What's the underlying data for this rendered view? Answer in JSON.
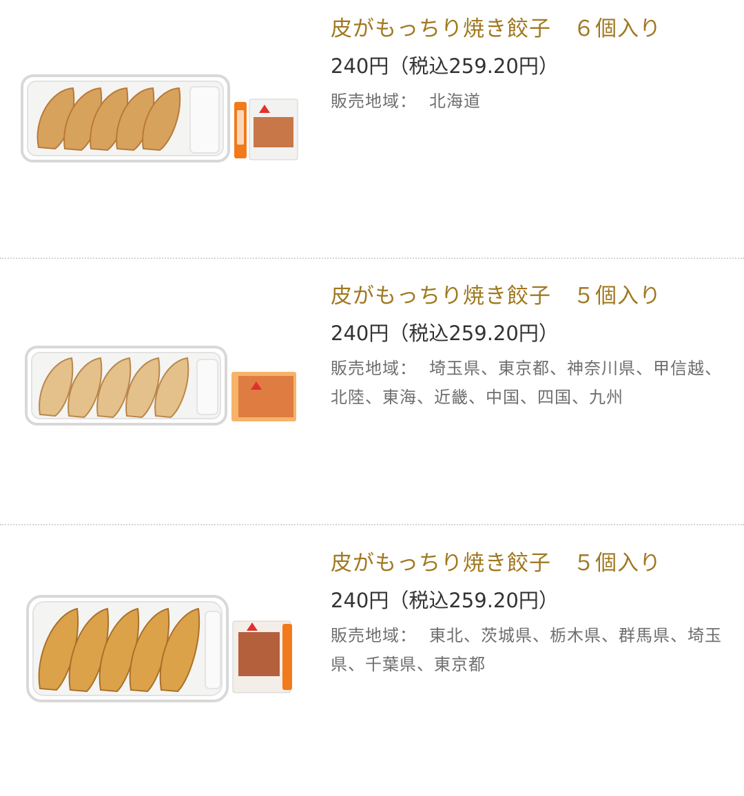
{
  "products": [
    {
      "name": "皮がもっちり焼き餃子　６個入り",
      "price": "240円（税込259.20円）",
      "region_label": "販売地域：",
      "region": "北海道",
      "image_icon": "gyoza-6-pack-photo"
    },
    {
      "name": "皮がもっちり焼き餃子　５個入り",
      "price": "240円（税込259.20円）",
      "region_label": "販売地域：",
      "region": "埼玉県、東京都、神奈川県、甲信越、北陸、東海、近畿、中国、四国、九州",
      "image_icon": "gyoza-5-pack-photo"
    },
    {
      "name": "皮がもっちり焼き餃子　５個入り",
      "price": "240円（税込259.20円）",
      "region_label": "販売地域：",
      "region": "東北、茨城県、栃木県、群馬県、埼玉県、千葉県、東京都",
      "image_icon": "gyoza-5-pack-photo"
    }
  ],
  "colors": {
    "title": "#a07820",
    "price": "#333333",
    "region": "#6e6e6e",
    "divider": "#d4d4d4"
  }
}
